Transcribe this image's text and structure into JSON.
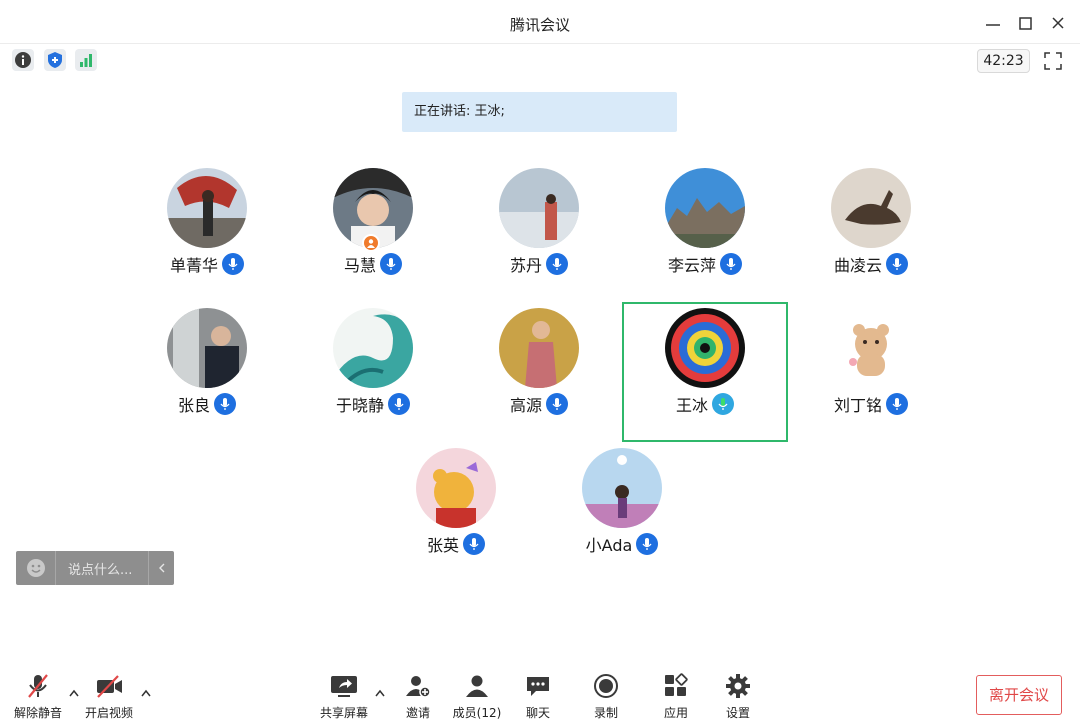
{
  "window": {
    "title": "腾讯会议",
    "meeting_timer": "42:23"
  },
  "banner": {
    "speaking": "正在讲话: 王冰;"
  },
  "participants": [
    {
      "name": "单菁华",
      "mic": "mic-icon"
    },
    {
      "name": "马慧",
      "mic": "mic-icon",
      "role": "host"
    },
    {
      "name": "苏丹",
      "mic": "mic-icon"
    },
    {
      "name": "李云萍",
      "mic": "mic-icon"
    },
    {
      "name": "曲凌云",
      "mic": "mic-icon"
    },
    {
      "name": "张良",
      "mic": "mic-icon"
    },
    {
      "name": "于晓静",
      "mic": "mic-icon"
    },
    {
      "name": "高源",
      "mic": "mic-icon"
    },
    {
      "name": "王冰",
      "mic": "mic-speaking-icon",
      "active": true
    },
    {
      "name": "刘丁铭",
      "mic": "mic-icon"
    },
    {
      "name": "张英",
      "mic": "mic-icon"
    },
    {
      "name": "小Ada",
      "mic": "mic-icon"
    }
  ],
  "chat": {
    "placeholder": "说点什么..."
  },
  "toolbar": {
    "unmute": "解除静音",
    "start_video": "开启视频",
    "share_screen": "共享屏幕",
    "invite": "邀请",
    "members": "成员(12)",
    "chat": "聊天",
    "record": "录制",
    "apps": "应用",
    "settings": "设置",
    "leave": "离开会议"
  },
  "colors": {
    "accent": "#1e6fe0",
    "active_border": "#2fb86b",
    "leave": "#e04848",
    "banner_bg": "#d9eaf9"
  }
}
